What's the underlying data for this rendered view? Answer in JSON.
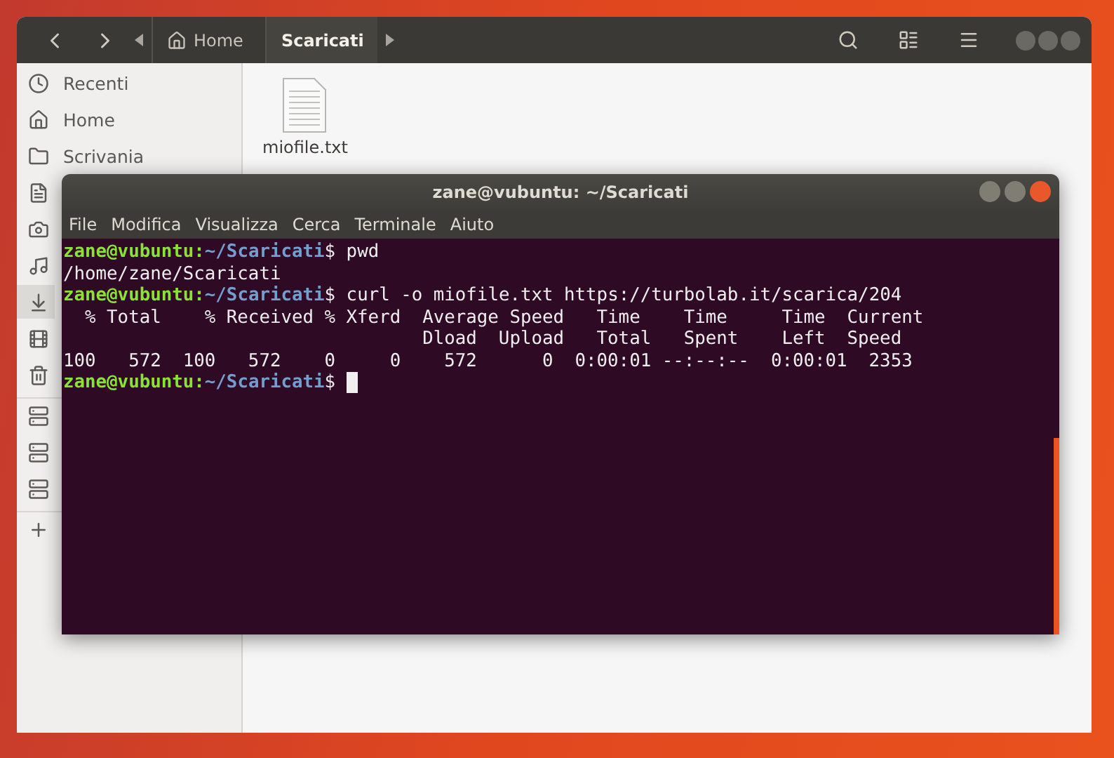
{
  "file_manager": {
    "path": [
      {
        "label": "Home",
        "kind": "home",
        "selected": false
      },
      {
        "label": "Scaricati",
        "kind": "folder",
        "selected": true
      }
    ],
    "sidebar": {
      "groups": [
        [
          {
            "kind": "recent",
            "label": "Recenti",
            "selected": false
          },
          {
            "kind": "home",
            "label": "Home",
            "selected": false
          },
          {
            "kind": "desktop",
            "label": "Scrivania",
            "selected": false
          },
          {
            "kind": "documents",
            "selected": false
          },
          {
            "kind": "pictures",
            "selected": false
          },
          {
            "kind": "music",
            "selected": false
          },
          {
            "kind": "downloads",
            "selected": true
          },
          {
            "kind": "videos",
            "selected": false
          },
          {
            "kind": "trash",
            "selected": false
          }
        ],
        [
          {
            "kind": "network",
            "selected": false
          },
          {
            "kind": "network",
            "selected": false
          },
          {
            "kind": "network",
            "selected": false
          }
        ],
        [
          {
            "kind": "add",
            "selected": false
          }
        ]
      ]
    },
    "files": [
      {
        "name": "miofile.txt"
      }
    ]
  },
  "terminal": {
    "title": "zane@vubuntu: ~/Scaricati",
    "menu": [
      "File",
      "Modifica",
      "Visualizza",
      "Cerca",
      "Terminale",
      "Aiuto"
    ],
    "lines": [
      {
        "kind": "prompt",
        "user": "zane@vubuntu:",
        "path": "~/Scaricati",
        "command": "$ pwd"
      },
      {
        "kind": "output",
        "text": "/home/zane/Scaricati"
      },
      {
        "kind": "prompt",
        "user": "zane@vubuntu:",
        "path": "~/Scaricati",
        "command": "$ curl -o miofile.txt https://turbolab.it/scarica/204"
      },
      {
        "kind": "output",
        "text": "  % Total    % Received % Xferd  Average Speed   Time    Time     Time  Current"
      },
      {
        "kind": "output",
        "text": "                                 Dload  Upload   Total   Spent    Left  Speed"
      },
      {
        "kind": "output",
        "text": "100   572  100   572    0     0    572      0  0:00:01 --:--:--  0:00:01  2353"
      },
      {
        "kind": "prompt",
        "user": "zane@vubuntu:",
        "path": "~/Scaricati",
        "command": "$ ",
        "cursor": true
      }
    ]
  }
}
